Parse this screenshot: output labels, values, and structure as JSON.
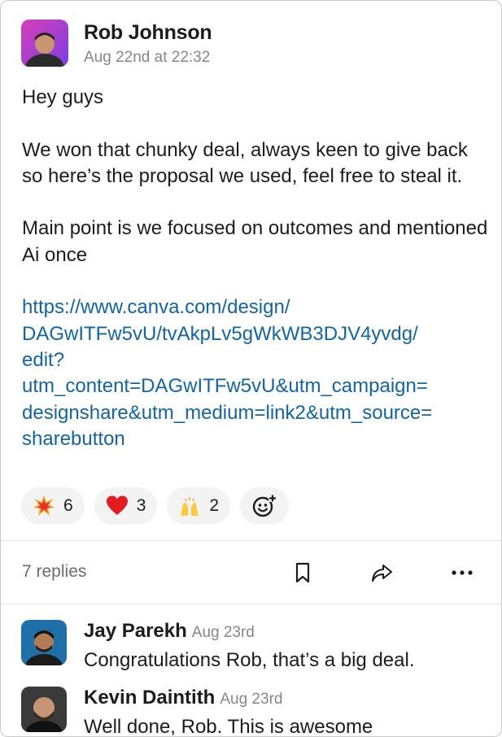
{
  "post": {
    "author": "Rob Johnson",
    "timestamp": "Aug 22nd at 22:32",
    "greeting": "Hey guys",
    "paragraph1": "We won that chunky deal, always keen to give back so here’s the proposal we used, feel free to steal it.",
    "paragraph2": "Main point is we focused on outcomes and mentioned Ai once",
    "link_lines": [
      "https://www.canva.com/design/",
      "DAGwITFw5vU/tvAkpLv5gWkWB3DJV4yvdg/",
      "edit?",
      "utm_content=DAGwITFw5vU&utm_campaign=",
      "designshare&utm_medium=link2&utm_source=",
      "sharebutton"
    ],
    "link_color": "#1264a3"
  },
  "reactions": [
    {
      "icon": "collision-emoji-icon",
      "count": "6"
    },
    {
      "icon": "red-heart-emoji-icon",
      "count": "3"
    },
    {
      "icon": "raised-hands-emoji-icon",
      "count": "2"
    }
  ],
  "add_reaction_icon": "add-reaction-icon",
  "thread": {
    "replies_label": "7 replies",
    "icons": [
      "bookmark-icon",
      "share-icon",
      "more-icon"
    ]
  },
  "replies": [
    {
      "name": "Jay Parekh",
      "time": "Aug 23rd",
      "text": "Congratulations Rob, that’s a big deal."
    },
    {
      "name": "Kevin Daintith",
      "time": "Aug 23rd",
      "text": "Well done, Rob. This is awesome"
    }
  ]
}
